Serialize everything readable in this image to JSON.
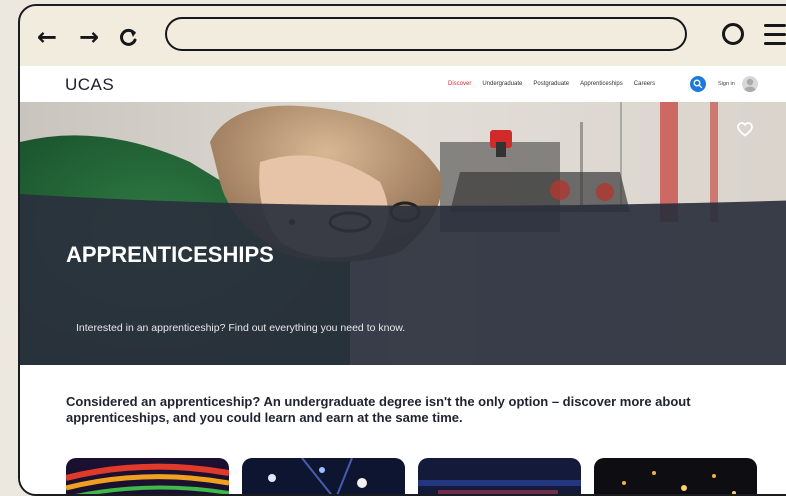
{
  "nav": {
    "logo": "UCAS",
    "links": [
      "Discover",
      "Undergraduate",
      "Postgraduate",
      "Apprenticeships",
      "Careers"
    ],
    "sign_in": "Sign in"
  },
  "hero": {
    "title": "APPRENTICESHIPS",
    "subtitle": "Interested in an apprenticeship? Find out everything you need to know."
  },
  "intro": {
    "text": "Considered an apprenticeship? An undergraduate degree isn't the only option – discover more about apprenticeships, and you could learn and earn at the same time."
  },
  "colors": {
    "accent_active": "#d62b3a",
    "search_blue": "#1d7ad9",
    "hero_dark": "#2a303d"
  },
  "icons": [
    "back-arrow-icon",
    "forward-arrow-icon",
    "reload-icon",
    "circle-icon",
    "menu-icon",
    "search-icon",
    "heart-icon",
    "avatar-icon"
  ]
}
